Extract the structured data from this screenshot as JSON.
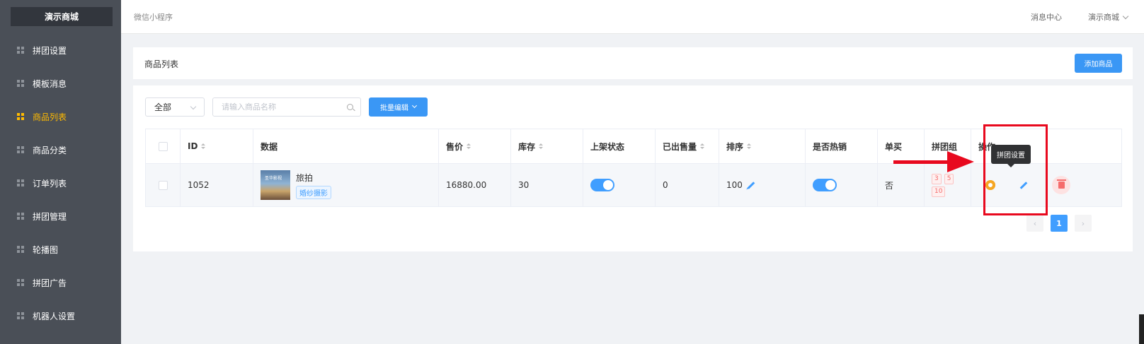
{
  "sidebar": {
    "brand": "演示商城",
    "items": [
      {
        "label": "拼团设置",
        "active": false
      },
      {
        "label": "模板消息",
        "active": false
      },
      {
        "label": "商品列表",
        "active": true
      },
      {
        "label": "商品分类",
        "active": false
      },
      {
        "label": "订单列表",
        "active": false
      },
      {
        "label": "拼团管理",
        "active": false
      },
      {
        "label": "轮播图",
        "active": false
      },
      {
        "label": "拼团广告",
        "active": false
      },
      {
        "label": "机器人设置",
        "active": false
      }
    ]
  },
  "header": {
    "breadcrumb": "微信小程序",
    "message_center": "消息中心",
    "user_menu": "演示商城"
  },
  "page": {
    "title": "商品列表",
    "add_button": "添加商品"
  },
  "filters": {
    "select_value": "全部",
    "search_placeholder": "请输入商品名称",
    "batch_button": "批量编辑"
  },
  "table": {
    "columns": [
      "ID",
      "数据",
      "售价",
      "库存",
      "上架状态",
      "已出售量",
      "排序",
      "是否热销",
      "单买",
      "拼团组",
      "操作"
    ],
    "rows": [
      {
        "id": "1052",
        "thumb_text": "圣华影视",
        "name": "旅拍",
        "tag": "婚纱摄影",
        "price": "16880.00",
        "stock": "30",
        "on_shelf": true,
        "sold": "0",
        "sort": "100",
        "hot": true,
        "single_buy": "否",
        "groups": [
          "3",
          "5",
          "10"
        ]
      }
    ]
  },
  "tooltip": "拼团设置",
  "pagination": {
    "current": "1",
    "prev": "‹",
    "next": "›"
  },
  "colors": {
    "sidebar_bg": "#4a4f57",
    "active": "#ffba00",
    "primary": "#409eff",
    "annotation": "#e8091e"
  }
}
